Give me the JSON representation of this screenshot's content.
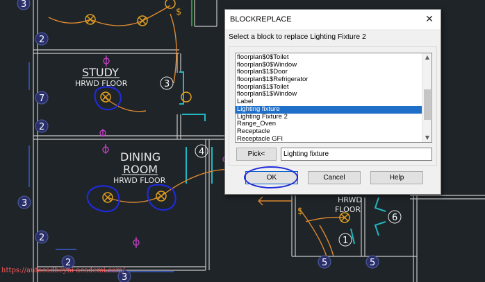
{
  "drawing": {
    "room_study": "STUDY",
    "floor_study": "HRWD  FLOOR",
    "room_dining_1": "DINING",
    "room_dining_2": "ROOM",
    "floor_dining": "HRWD  FLOOR",
    "floor_right_1": "HRWD",
    "floor_right_2": "FLOOR",
    "bubbles": [
      "3",
      "2",
      "7",
      "2",
      "3",
      "2",
      "2",
      "3",
      "3",
      "4",
      "1",
      "5",
      "5",
      "6"
    ],
    "watermark": "https://autocadbeyni-academi.com/"
  },
  "dialog": {
    "title": "BLOCKREPLACE",
    "close_glyph": "✕",
    "prompt": "Select a block to replace Lighting Fixture 2",
    "list_items": [
      "floorplan$0$Toilet",
      "floorplan$0$Window",
      "floorplan$1$Door",
      "floorplan$1$Refrigerator",
      "floorplan$1$Toilet",
      "floorplan$1$Window",
      "Label",
      "Lighting fixture",
      "Lighting Fixture 2",
      "Range_Oven",
      "Receptacle",
      "Receptacle GFI"
    ],
    "selected_item": "Lighting fixture",
    "scroll_up_glyph": "▲",
    "scroll_down_glyph": "▼",
    "pick_button": "Pick<",
    "pick_value": "Lighting fixture",
    "ok_button": "OK",
    "cancel_button": "Cancel",
    "help_button": "Help"
  },
  "colors": {
    "background": "#1f2428",
    "wall": "#c8c8c8",
    "fixture": "#e0a020",
    "wiring": "#e08a30",
    "receptacle": "#c040c0",
    "bubble": "#2a2f6a",
    "annotation": "#1f2bd6",
    "door": "#20b8c0",
    "selection": "#1f6fc8"
  }
}
